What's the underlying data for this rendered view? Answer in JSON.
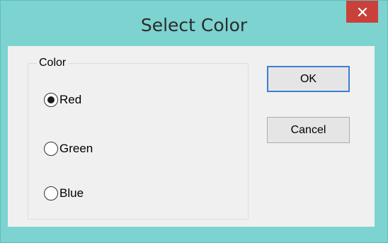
{
  "dialog": {
    "title": "Select Color",
    "close_icon": "close-icon",
    "close_glyph": "✕"
  },
  "color_group": {
    "legend": "Color",
    "options": [
      {
        "label": "Red",
        "selected": true
      },
      {
        "label": "Green",
        "selected": false
      },
      {
        "label": "Blue",
        "selected": false
      }
    ]
  },
  "buttons": {
    "ok_label": "OK",
    "cancel_label": "Cancel"
  },
  "colors": {
    "title_bar": "#7dd3d0",
    "close_button": "#c9413a",
    "dialog_body": "#f0f0f0",
    "default_button_border": "#3c7fd1"
  }
}
